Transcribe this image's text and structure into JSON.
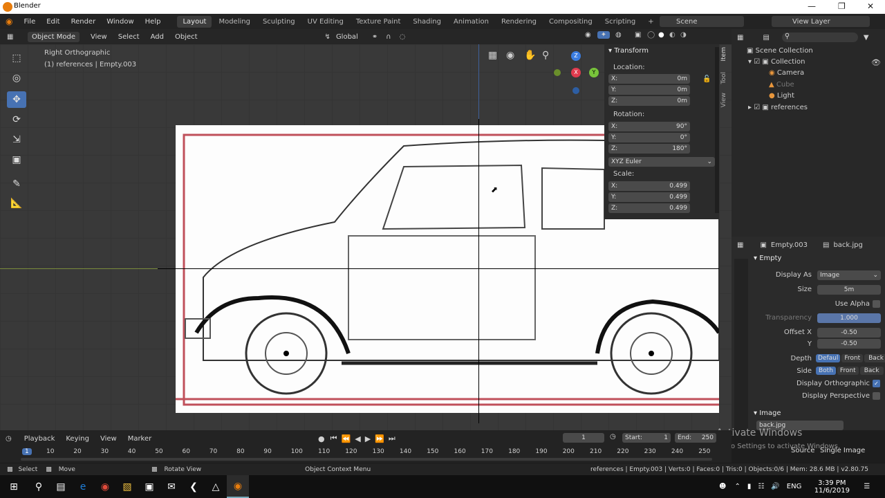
{
  "window": {
    "title": "Blender"
  },
  "menu": [
    "File",
    "Edit",
    "Render",
    "Window",
    "Help"
  ],
  "workspaces": [
    "Layout",
    "Modeling",
    "Sculpting",
    "UV Editing",
    "Texture Paint",
    "Shading",
    "Animation",
    "Rendering",
    "Compositing",
    "Scripting"
  ],
  "scene_label": "Scene",
  "view_layer_label": "View Layer",
  "vheader": {
    "mode": "Object Mode",
    "menus": [
      "View",
      "Select",
      "Add",
      "Object"
    ],
    "orientation": "Global"
  },
  "viewport": {
    "view_name": "Right Orthographic",
    "context": "(1) references  | Empty.003"
  },
  "npanel": {
    "title": "Transform",
    "location_label": "Location:",
    "loc": [
      {
        "axis": "X:",
        "val": "0m"
      },
      {
        "axis": "Y:",
        "val": "0m"
      },
      {
        "axis": "Z:",
        "val": "0m"
      }
    ],
    "rotation_label": "Rotation:",
    "rot": [
      {
        "axis": "X:",
        "val": "90°"
      },
      {
        "axis": "Y:",
        "val": "0°"
      },
      {
        "axis": "Z:",
        "val": "180°"
      }
    ],
    "rot_mode": "XYZ Euler",
    "scale_label": "Scale:",
    "scale": [
      {
        "axis": "X:",
        "val": "0.499"
      },
      {
        "axis": "Y:",
        "val": "0.499"
      },
      {
        "axis": "Z:",
        "val": "0.499"
      }
    ],
    "tabs": [
      "Item",
      "Tool",
      "View"
    ]
  },
  "outliner": {
    "root": "Scene Collection",
    "items": [
      {
        "name": "Collection"
      },
      {
        "name": "Camera"
      },
      {
        "name": "Cube"
      },
      {
        "name": "Light"
      },
      {
        "name": "references"
      }
    ]
  },
  "props": {
    "object": "Empty.003",
    "image": "back.jpg",
    "section": "Empty",
    "display_as_label": "Display As",
    "display_as": "Image",
    "size_label": "Size",
    "size": "5m",
    "use_alpha": "Use Alpha",
    "transparency_label": "Transparency",
    "transparency": "1.000",
    "offsetx_label": "Offset X",
    "offsetx": "-0.50",
    "offsety_label": "Y",
    "offsety": "-0.50",
    "depth_label": "Depth",
    "depth": [
      "Defaul",
      "Front",
      "Back"
    ],
    "side_label": "Side",
    "side": [
      "Both",
      "Front",
      "Back"
    ],
    "disp_ortho": "Display Orthographic",
    "disp_persp": "Display Perspective",
    "image_section": "Image",
    "image_name": "back.jpg",
    "source_label": "Source",
    "source": "Single Image"
  },
  "timeline": {
    "menus": [
      "Playback",
      "Keying",
      "View",
      "Marker"
    ],
    "frame": "1",
    "start_label": "Start:",
    "start": "1",
    "end_label": "End:",
    "end": "250",
    "ticks": [
      "1",
      "10",
      "20",
      "30",
      "40",
      "50",
      "60",
      "70",
      "80",
      "90",
      "100",
      "110",
      "120",
      "130",
      "140",
      "150",
      "160",
      "170",
      "180",
      "190",
      "200",
      "210",
      "220",
      "230",
      "240",
      "250"
    ]
  },
  "watermark": {
    "line1": "Activate Windows",
    "line2": "Go to Settings to activate Windows."
  },
  "status": {
    "select": "Select",
    "move": "Move",
    "rotate": "Rotate View",
    "context": "Object Context Menu",
    "info": "references | Empty.003 | Verts:0 | Faces:0 | Tris:0 | Objects:0/6 | Mem: 28.6 MB | v2.80.75"
  },
  "taskbar": {
    "lang": "ENG",
    "time": "3:39 PM",
    "date": "11/6/2019"
  }
}
